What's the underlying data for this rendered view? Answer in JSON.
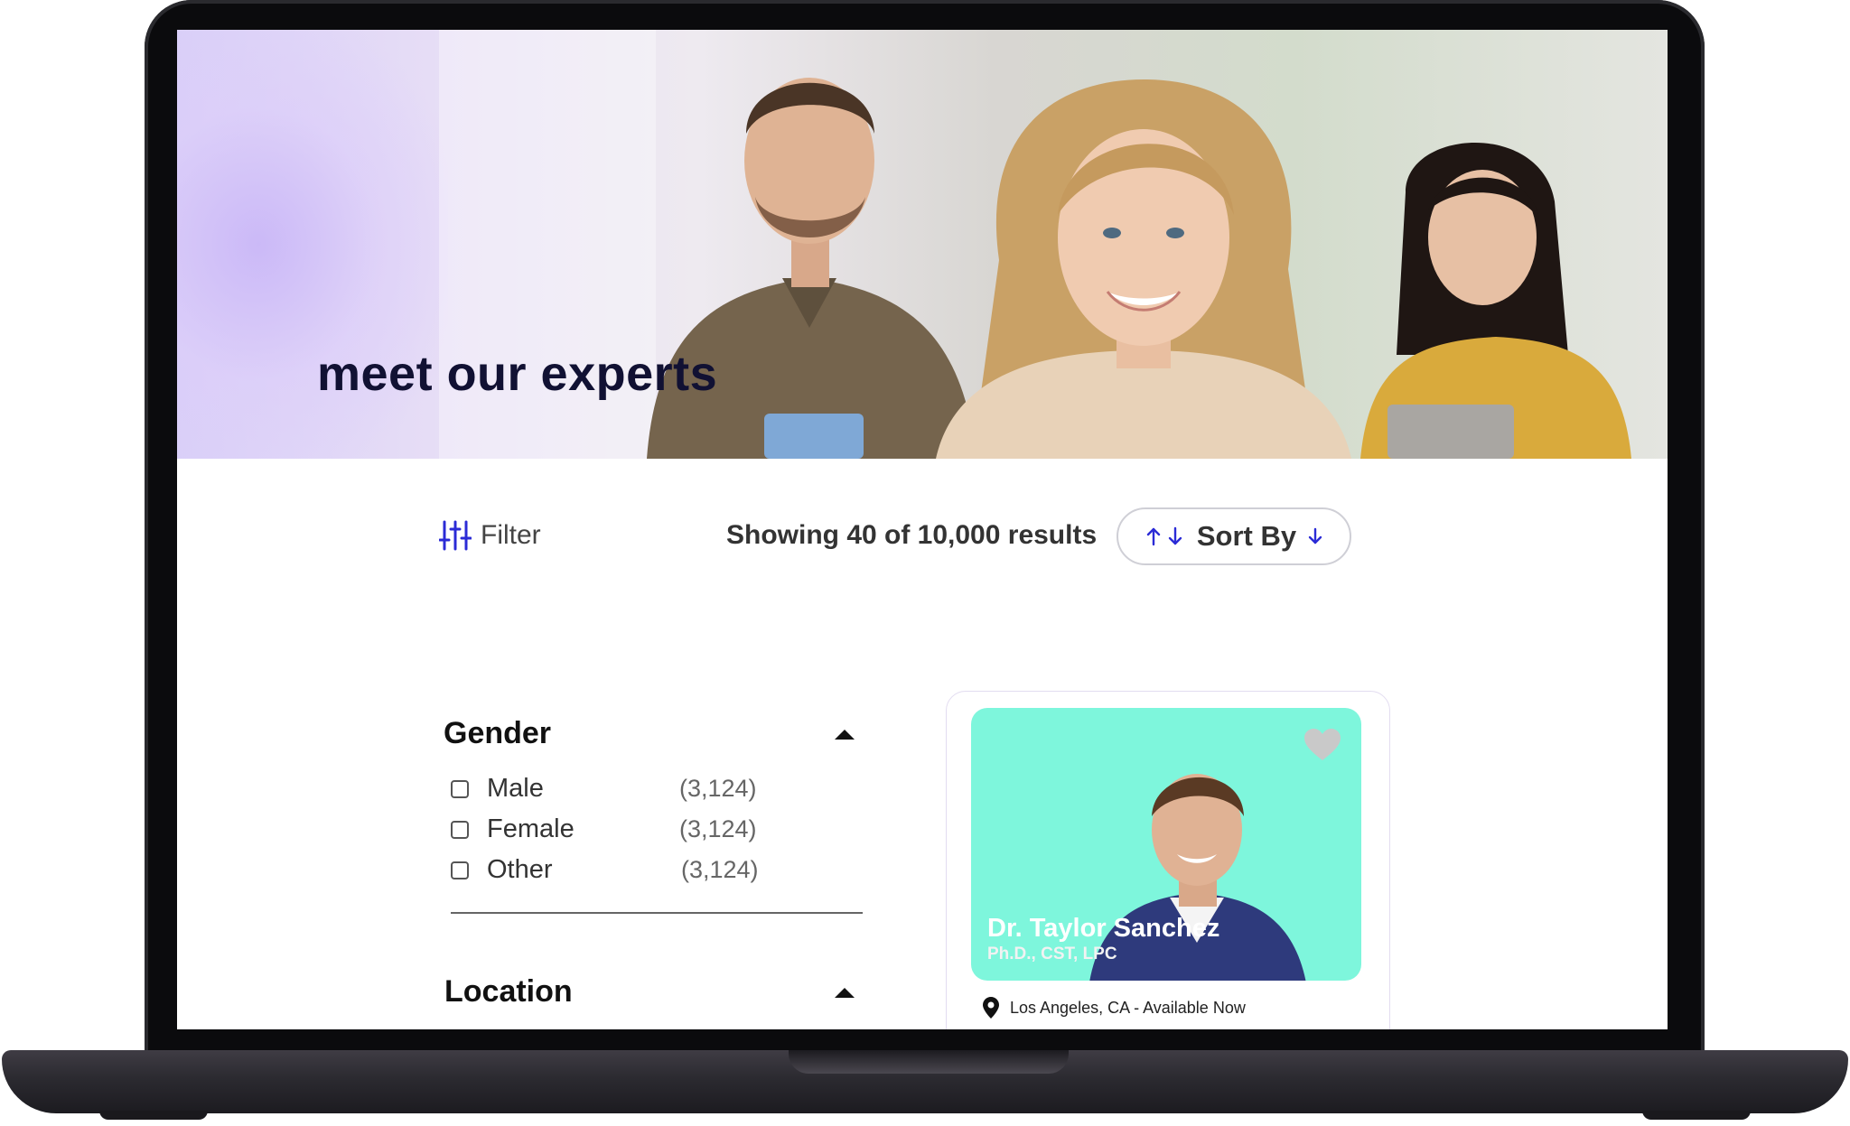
{
  "hero": {
    "title": "meet our experts"
  },
  "toolbar": {
    "filter_label": "Filter",
    "results_text": "Showing 40 of 10,000 results",
    "sort_label": "Sort By"
  },
  "filters": {
    "gender": {
      "title": "Gender",
      "options": [
        {
          "label": "Male",
          "count": "(3,124)"
        },
        {
          "label": "Female",
          "count": "(3,124)"
        },
        {
          "label": "Other",
          "count": "(3,124)"
        }
      ]
    },
    "location": {
      "title": "Location"
    }
  },
  "expert_card": {
    "name": "Dr. Taylor Sanchez",
    "credentials": "Ph.D., CST, LPC",
    "location": "Los Angeles, CA - Available Now",
    "photo_bg_color": "#7ef6dc",
    "favorite_icon": "heart-icon"
  },
  "colors": {
    "accent": "#2b2bd6",
    "hero_title": "#111133"
  }
}
